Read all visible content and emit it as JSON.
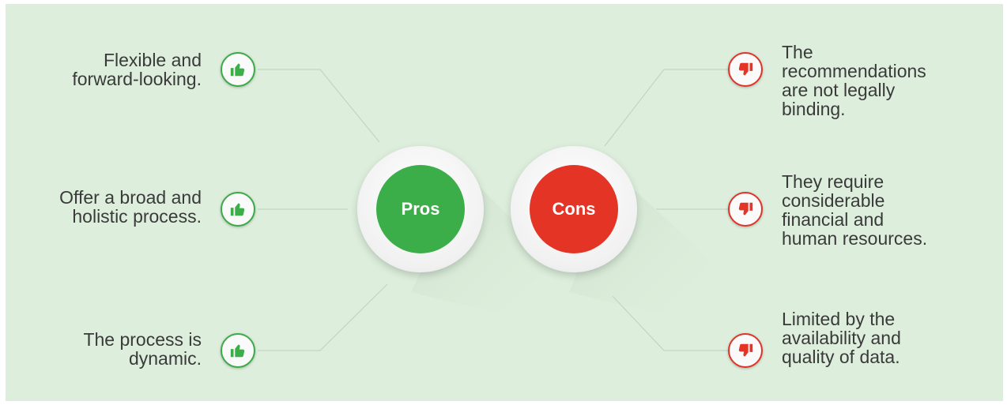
{
  "hubs": {
    "pros_label": "Pros",
    "cons_label": "Cons"
  },
  "pros": [
    {
      "text": "Flexible and\nforward-looking.",
      "icon": "thumbs-up-icon"
    },
    {
      "text": "Offer a broad and\nholistic process.",
      "icon": "thumbs-up-icon"
    },
    {
      "text": "The process is\ndynamic.",
      "icon": "thumbs-up-icon"
    }
  ],
  "cons": [
    {
      "text": "The\nrecommendations\nare not legally\nbinding.",
      "icon": "thumbs-down-icon"
    },
    {
      "text": "They require\nconsiderable\nfinancial and\nhuman resources.",
      "icon": "thumbs-down-icon"
    },
    {
      "text": "Limited by the\navailability and\nquality of data.",
      "icon": "thumbs-down-icon"
    }
  ],
  "colors": {
    "background": "#ddefdc",
    "pros_accent": "#3cae49",
    "cons_accent": "#e33426",
    "text": "#3a3a3a"
  }
}
